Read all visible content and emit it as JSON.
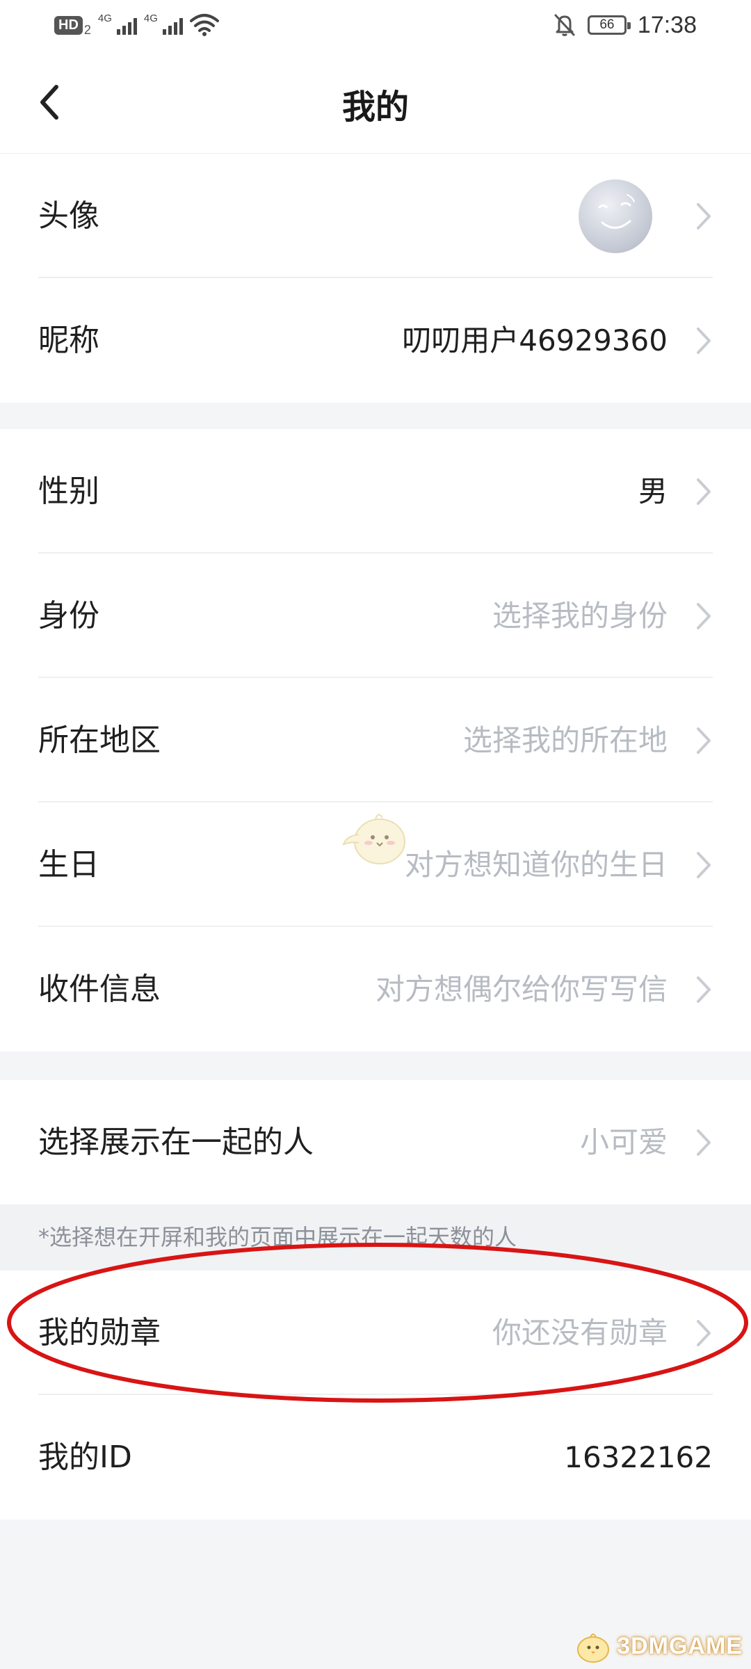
{
  "status_bar": {
    "hd_label": "HD",
    "hd_sub": "2",
    "signal1_tag": "4G",
    "signal2_tag": "4G",
    "battery_level": "66",
    "time": "17:38"
  },
  "header": {
    "title": "我的",
    "back_icon": "chevron-left-icon"
  },
  "profile": {
    "avatar_label": "头像",
    "nickname_label": "昵称",
    "nickname_value": "叨叨用户46929360"
  },
  "details": {
    "gender_label": "性别",
    "gender_value": "男",
    "identity_label": "身份",
    "identity_placeholder": "选择我的身份",
    "region_label": "所在地区",
    "region_placeholder": "选择我的所在地",
    "birthday_label": "生日",
    "birthday_placeholder": "对方想知道你的生日",
    "address_label": "收件信息",
    "address_placeholder": "对方想偶尔给你写写信"
  },
  "together": {
    "label": "选择展示在一起的人",
    "value": "小可爱",
    "hint": "*选择想在开屏和我的页面中展示在一起天数的人"
  },
  "badges": {
    "label": "我的勋章",
    "placeholder": "你还没有勋章",
    "annotation_color": "#d81414"
  },
  "account": {
    "id_label": "我的ID",
    "id_value": "16322162"
  },
  "watermark": {
    "text": "3DMGAME"
  },
  "colors": {
    "background": "#f4f5f7",
    "card": "#ffffff",
    "placeholder_text": "#b7bbc2",
    "primary_text": "#1f1f1f"
  }
}
